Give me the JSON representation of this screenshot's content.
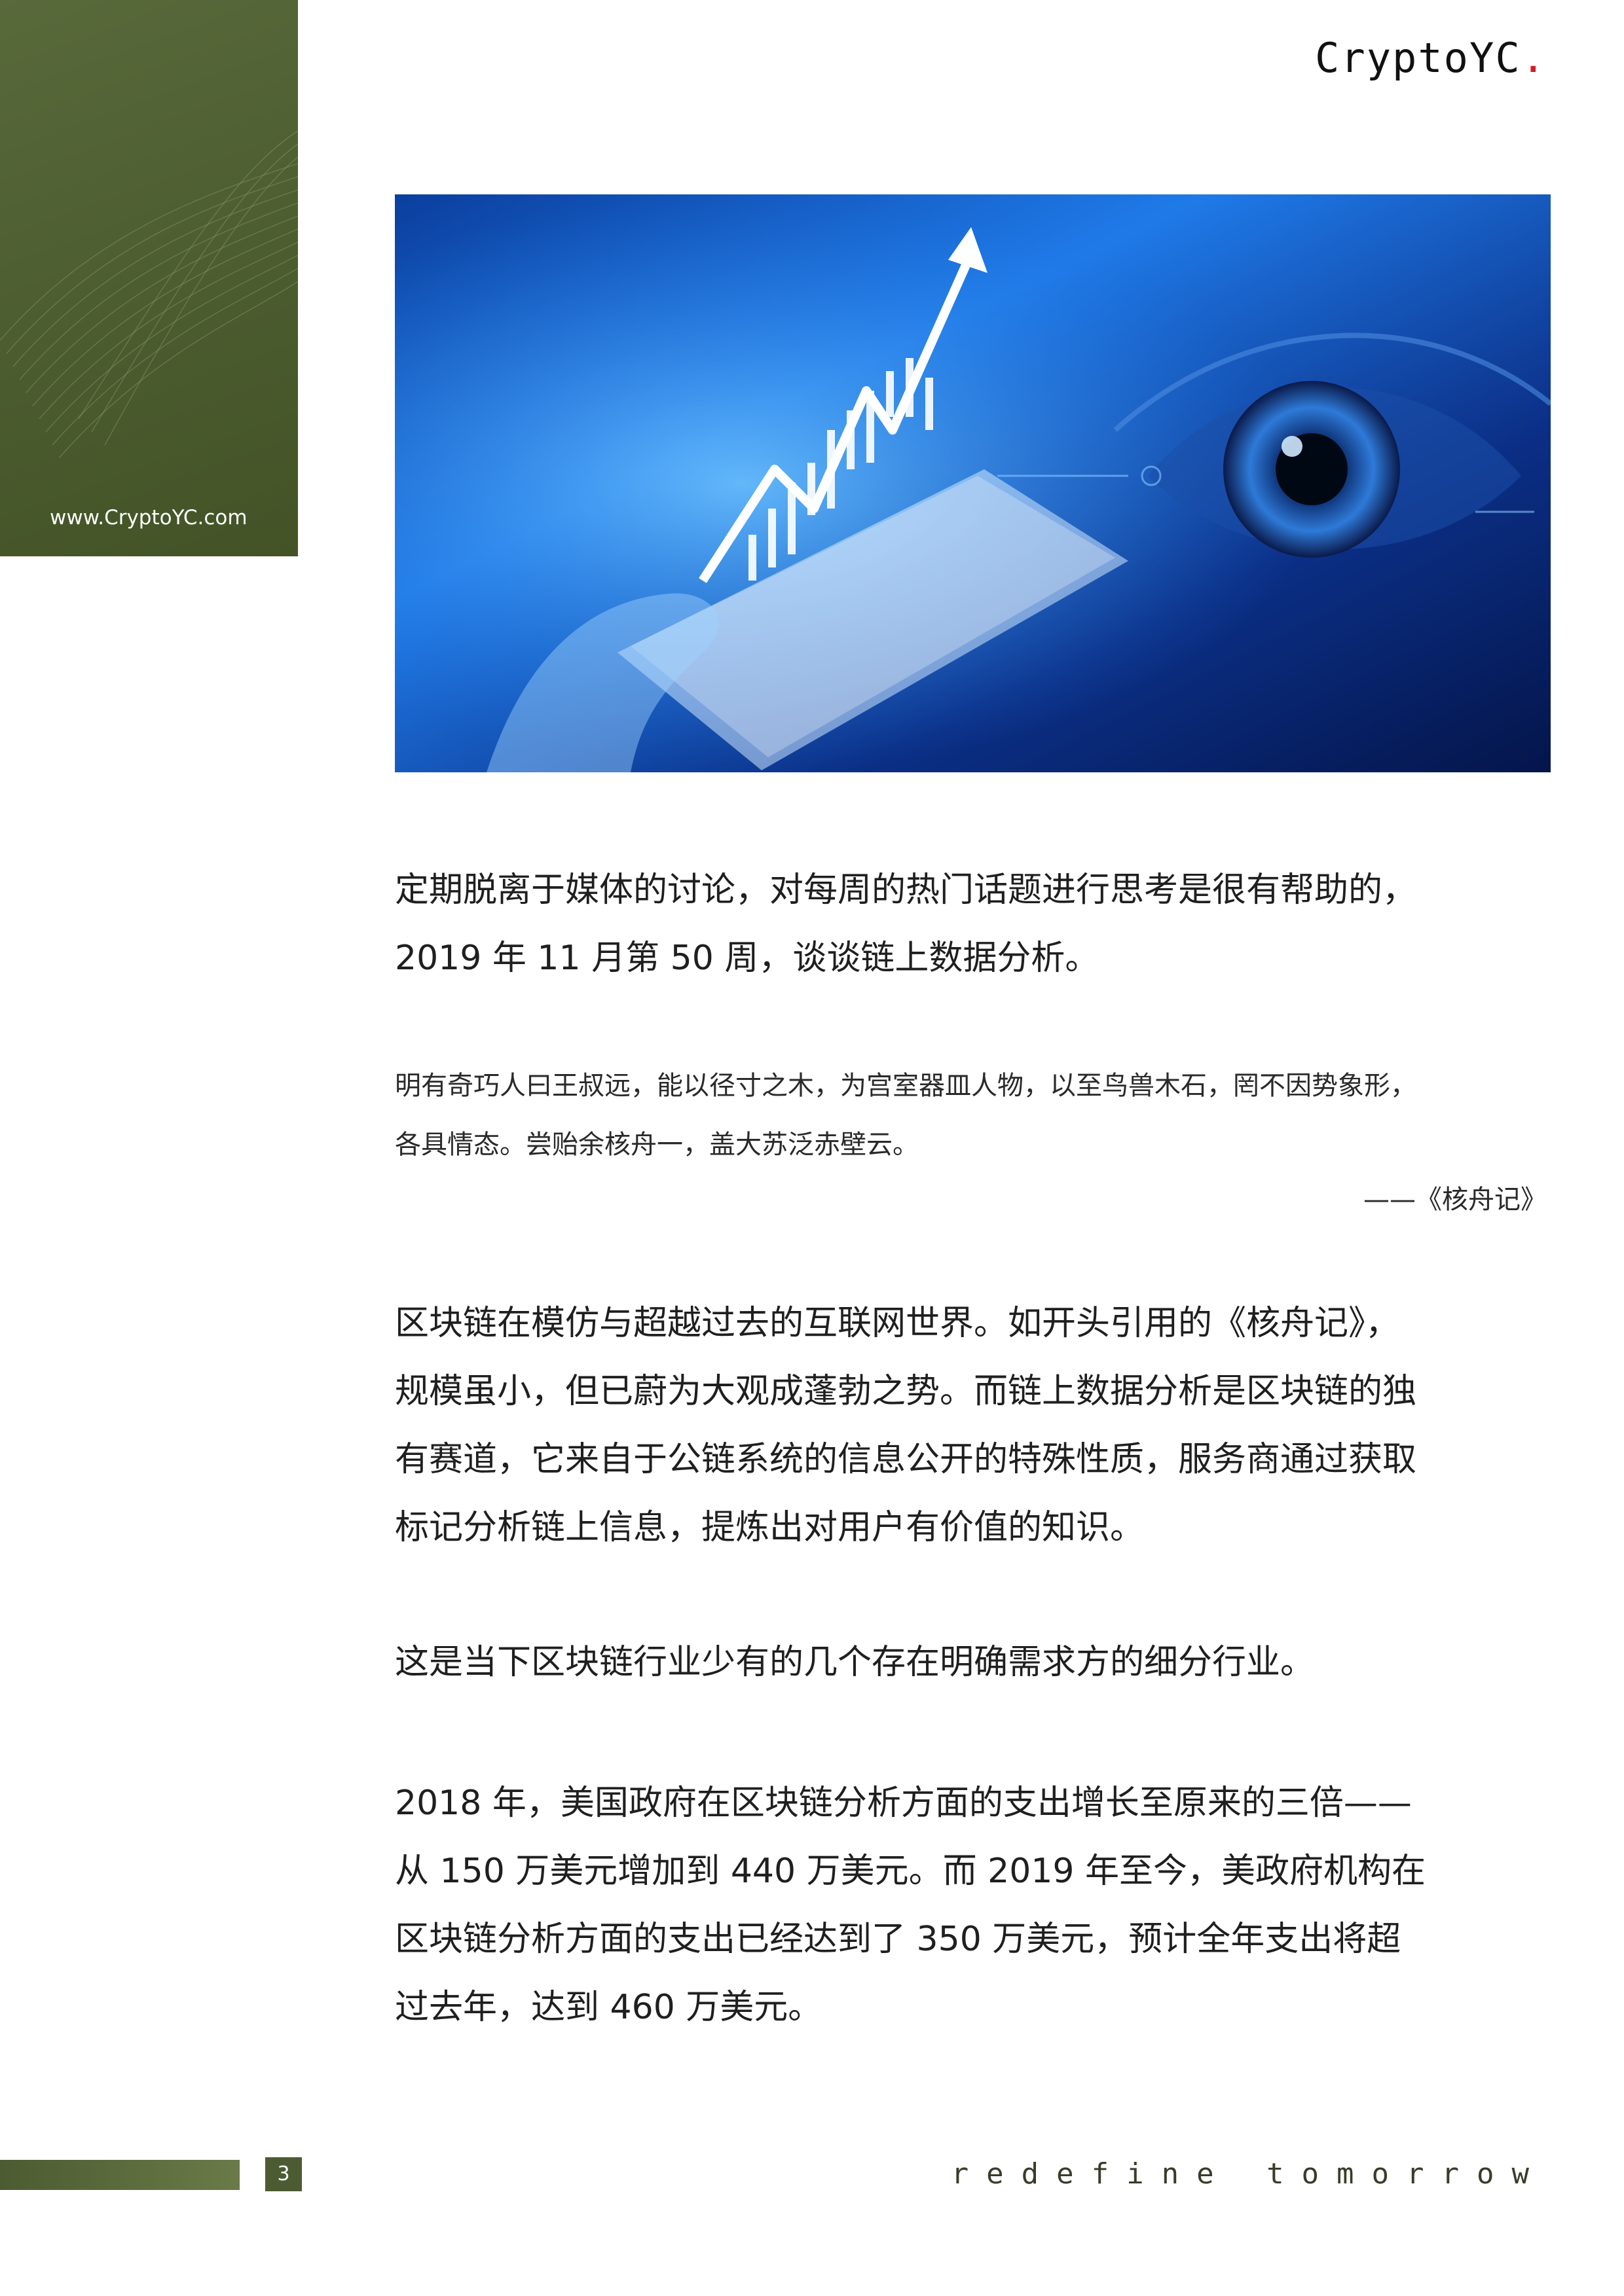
{
  "header": {
    "logo_text": "CryptoYC",
    "logo_dot": "."
  },
  "banner": {
    "url": "www.CryptoYC.com"
  },
  "hero": {
    "alt": ""
  },
  "paragraphs": {
    "intro_1": "定期脱离于媒体的讨论，对每周的热门话题进行思考是很有帮助的，",
    "intro_2": "2019 年 11 月第 50 周，谈谈链上数据分析。",
    "quote_1": "明有奇巧人曰王叔远，能以径寸之木，为宫室器皿人物，以至鸟兽木石，罔不因势象形，",
    "quote_2": "各具情态。尝贻余核舟一，盖大苏泛赤壁云。",
    "quote_source": "——《核舟记》",
    "p1_1": "区块链在模仿与超越过去的互联网世界。如开头引用的《核舟记》，",
    "p1_2": "规模虽小，但已蔚为大观成蓬勃之势。而链上数据分析是区块链的独",
    "p1_3": "有赛道，它来自于公链系统的信息公开的特殊性质，服务商通过获取",
    "p1_4": "标记分析链上信息，提炼出对用户有价值的知识。",
    "p2_1": "这是当下区块链行业少有的几个存在明确需求方的细分行业。",
    "p3_1": "2018 年，美国政府在区块链分析方面的支出增长至原来的三倍——",
    "p3_2": "从 150 万美元增加到 440 万美元。而 2019 年至今，美政府机构在",
    "p3_3": "区块链分析方面的支出已经达到了 350 万美元，预计全年支出将超",
    "p3_4": "过去年，达到 460 万美元。"
  },
  "footer": {
    "page_number": "3",
    "tagline": "redefine tomorrow"
  },
  "colors": {
    "brand_green": "#4c5b31",
    "logo_dot": "#d0202a",
    "hero_blue": "#1e6fe0"
  }
}
